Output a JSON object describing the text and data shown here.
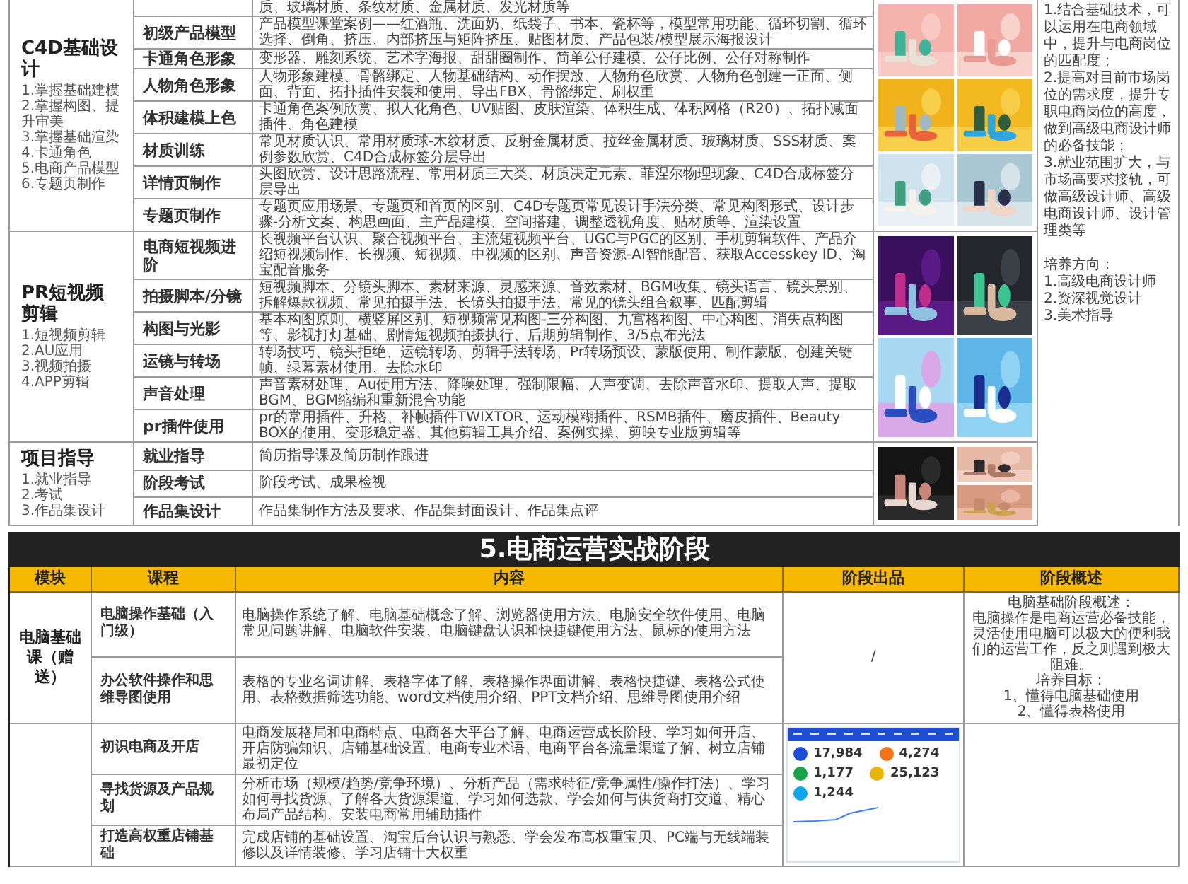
{
  "curriculum": {
    "modules": [
      {
        "title": "C4D基础设计",
        "points": [
          "1.掌握基础建模",
          "2.掌握构图、提升审美",
          "3.掌握基础渲染",
          "4.卡通角色",
          "5.电商产品模型",
          "6.专题页制作"
        ],
        "courses": [
          {
            "content": "质、玻璃材质、条纹材质、金属材质、发光材质等"
          },
          {
            "name": "初级产品模型",
            "content": "产品模型课堂案例——红酒瓶、洗面奶、纸袋子、书本、瓷杯等，模型常用功能、循环切割、循环选择、倒角、挤压、内部挤压与矩阵挤压、贴图材质、产品包装/模型展示海报设计"
          },
          {
            "name": "卡通角色形象",
            "content": "变形器、雕刻系统、艺术字海报、甜甜圈制作、简单公仔建模、公仔比例、公仔对称制作"
          },
          {
            "name": "人物角色形象",
            "content": "人物形象建模、骨骼绑定、人物基础结构、动作摆放、人物角色欣赏、人物角色创建一正面、侧面、背面、拓扑插件安装和使用、导出FBX、骨骼绑定、刷权重"
          },
          {
            "name": "体积建模上色",
            "content": "卡通角色案例欣赏、拟人化角色、UV贴图、皮肤渲染、体积生成、体积网格（R20）、拓扑减面插件、角色建模"
          },
          {
            "name": "材质训练",
            "content": "常见材质认识、常用材质球-木纹材质、反射金属材质、拉丝金属材质、玻璃材质、SSS材质、案例参数欣赏、C4D合成标签分层导出"
          },
          {
            "name": "详情页制作",
            "content": "头图欣赏、设计思路流程、常用材质三大类、材质决定元素、菲涅尔物理现象、C4D合成标签分层导出"
          },
          {
            "name": "专题页制作",
            "content": "专题页应用场景、专题页和首页的区别、C4D专题页常见设计手法分类、常见构图形式、设计步骤-分析文案、构思画面、主产品建模、空间搭建、调整透视角度、贴材质等、渲染设置"
          }
        ],
        "pictures": [
          {
            "kind": "picture"
          },
          {
            "kind": "picture"
          },
          {
            "kind": "picture"
          },
          {
            "kind": "picture"
          },
          {
            "kind": "picture"
          },
          {
            "kind": "picture"
          }
        ]
      },
      {
        "title": "PR短视频剪辑",
        "points": [
          "1.短视频剪辑",
          "2.AU应用",
          "3.视频拍摄",
          "4.APP剪辑"
        ],
        "courses": [
          {
            "name": "电商短视频进阶",
            "content": "长视频平台认识、聚合视频平台、主流短视频平台、UGC与PGC的区别、手机剪辑软件、产品介绍短视频制作、长视频、短视频、中视频的区别、声音资源-AI智能配音、获取Accesskey ID、淘宝配音服务"
          },
          {
            "name": "拍摄脚本/分镜",
            "content": "短视频脚本、分镜头脚本、素材来源、灵感来源、音效素材、BGM收集、镜头语言、镜头景别、拆解爆款视频、常见拍摄手法、长镜头拍摄手法、常见的镜头组合叙事、匹配剪辑"
          },
          {
            "name": "构图与光影",
            "content": "基本构图原则、横竖屏区别、短视频常见构图-三分构图、九宫格构图、中心构图、消失点构图等、影视打灯基础、剧情短视频拍摄执行、后期剪辑制作、3/5点布光法"
          },
          {
            "name": "运镜与转场",
            "content": "转场技巧、镜头拒绝、运镜转场、剪辑手法转场、Pr转场预设、蒙版使用、制作蒙版、创建关键帧、绿幕素材使用、去除水印"
          },
          {
            "name": "声音处理",
            "content": "声音素材处理、Au使用方法、降噪处理、强制限幅、人声变调、去除声音水印、提取人声、提取BGM、BGM缩编和重新混合功能"
          },
          {
            "name": "pr插件使用",
            "content": "pr的常用插件、升格、补帧插件TWIXTOR、运动模糊插件、RSMB插件、磨皮插件、Beauty BOX的使用、变形稳定器、其他剪辑工具介绍、案例实操、剪映专业版剪辑等"
          }
        ],
        "pictures": [
          {
            "kind": "picture"
          },
          {
            "kind": "picture"
          },
          {
            "kind": "picture"
          },
          {
            "kind": "picture"
          }
        ]
      },
      {
        "title": "项目指导",
        "points": [
          "1.就业指导",
          "2.考试",
          "3.作品集设计"
        ],
        "courses": [
          {
            "name": "就业指导",
            "content": "简历指导课及简历制作跟进"
          },
          {
            "name": "阶段考试",
            "content": "阶段考试、成果检视"
          },
          {
            "name": "作品集设计",
            "content": "作品集制作方法及要求、作品集封面设计、作品集点评"
          }
        ],
        "pictures": [
          {
            "kind": "picture"
          },
          {
            "kind": "picture"
          },
          {
            "kind": "picture"
          }
        ]
      }
    ],
    "overview": [
      "1.结合基础技术，可以运用在电商领域中，提升与电商岗位的匹配度；",
      "2.提高对目前市场岗位的需求度，提升专职电商岗位的高度，做到高级电商设计师的必备技能；",
      "3.就业范围扩大，与市场高要求接轨，可做高级设计师、高级电商设计师、设计管理类等",
      "培养方向：",
      "1.高级电商设计师",
      "2.资深视觉设计",
      "3.美术指导"
    ]
  },
  "stage5": {
    "title": "5.电商运营实战阶段",
    "columns": [
      "模块",
      "课程",
      "内容",
      "阶段出品",
      "阶段概述"
    ],
    "modules": [
      {
        "name": "电脑基础课（赠送）",
        "courses": [
          {
            "name": "电脑操作基础（入门级）",
            "content": "电脑操作系统了解、电脑基础概念了解、浏览器使用方法、电脑安全软件使用、电脑常见问题讲解、电脑软件安装、电脑键盘认识和快捷键使用方法、鼠标的使用方法"
          },
          {
            "name": "办公软件操作和思维导图使用",
            "content": "表格的专业名词讲解、表格字体了解、表格操作界面讲解、表格快捷键、表格公式使用、表格数据筛选功能、word文档使用介绍、PPT文档介绍、思维导图使用介绍"
          }
        ],
        "output": {
          "kind": "text",
          "text": "/"
        },
        "overview": [
          "电脑基础阶段概述：",
          "电脑操作是电商运营必备技能，灵活使用电脑可以极大的便利我们的运营工作，反之则遇到极大阻难。",
          "培养目标：",
          "1、懂得电脑基础使用",
          "2、懂得表格使用"
        ]
      },
      {
        "courses": [
          {
            "name": "初识电商及开店",
            "content": "电商发展格局和电商特点、电商各大平台了解、电商运营成长阶段、学习如何开店、开店防骗知识、店铺基础设置、电商专业术语、电商平台各流量渠道了解、树立店铺最初定位"
          },
          {
            "name": "寻找货源及产品规划",
            "content": "分析市场（规模/趋势/竞争环境）、分析产品（需求特征/竞争属性/操作打法）、学习如何寻找货源、了解各大货源渠道、学习如何选款、学会如何与供货商打交道、精心布局产品结构、安装电商常用辅助插件"
          },
          {
            "name": "打造高权重店铺基础",
            "content": "完成店铺的基础设置、淘宝后台认识与熟悉、学会发布高权重宝贝、PC端与无线端装修以及详情装修、学习店铺十大权重"
          }
        ],
        "output": {
          "kind": "dashboard",
          "stats": [
            {
              "value": "17,984",
              "color": "#1d4ed8"
            },
            {
              "value": "4,274",
              "color": "#f97316"
            },
            {
              "value": "1,177",
              "color": "#16a34a"
            },
            {
              "value": "25,123",
              "color": "#eab308"
            },
            {
              "value": "1,244",
              "color": "#0ea5e9"
            }
          ]
        }
      }
    ]
  }
}
